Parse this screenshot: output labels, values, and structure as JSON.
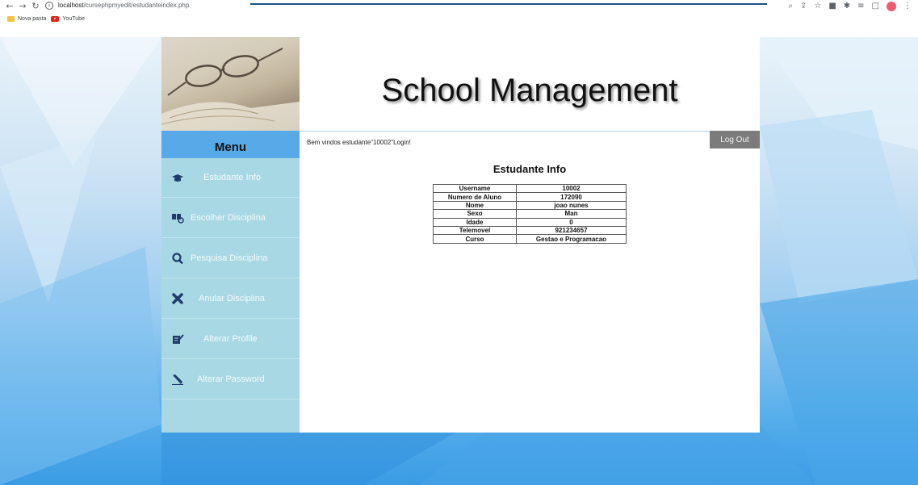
{
  "browser": {
    "url_host": "localhost",
    "url_path": "/cursephpmyedit/estudanteindex.php",
    "bookmarks": [
      {
        "label": "Nova pasta",
        "icon": "folder-icon"
      },
      {
        "label": "YouTube",
        "icon": "youtube-icon"
      }
    ],
    "profile_color": "#ef5b6f"
  },
  "header": {
    "title": "School Management"
  },
  "sidebar": {
    "menu_title": "Menu",
    "items": [
      {
        "label": "Estudante Info",
        "icon": "graduation-cap-icon"
      },
      {
        "label": "Escolher Disciplina",
        "icon": "select-course-icon"
      },
      {
        "label": "Pesquisa Disciplina",
        "icon": "search-icon"
      },
      {
        "label": "Anular Disciplina",
        "icon": "cancel-x-icon"
      },
      {
        "label": "Alterar Profile",
        "icon": "edit-profile-icon"
      },
      {
        "label": "Alterar Password",
        "icon": "pen-icon"
      }
    ]
  },
  "main": {
    "welcome": "Bem vindos estudante\"10002\"Login!",
    "logout_label": "Log Out",
    "section_title": "Estudante Info",
    "table": [
      {
        "key": "Username",
        "value": "10002"
      },
      {
        "key": "Numero de Aluno",
        "value": "172090"
      },
      {
        "key": "Nome",
        "value": "joao nunes"
      },
      {
        "key": "Sexo",
        "value": "Man"
      },
      {
        "key": "Idade",
        "value": "0"
      },
      {
        "key": "Telemovel",
        "value": "921234657"
      },
      {
        "key": "Curso",
        "value": "Gestao e Programacao"
      }
    ]
  },
  "colors": {
    "menu_header": "#57a9e8",
    "sidebar": "#a8d8e3",
    "logout_button": "#7b7b7b",
    "icon_navy": "#1f3b6e"
  }
}
